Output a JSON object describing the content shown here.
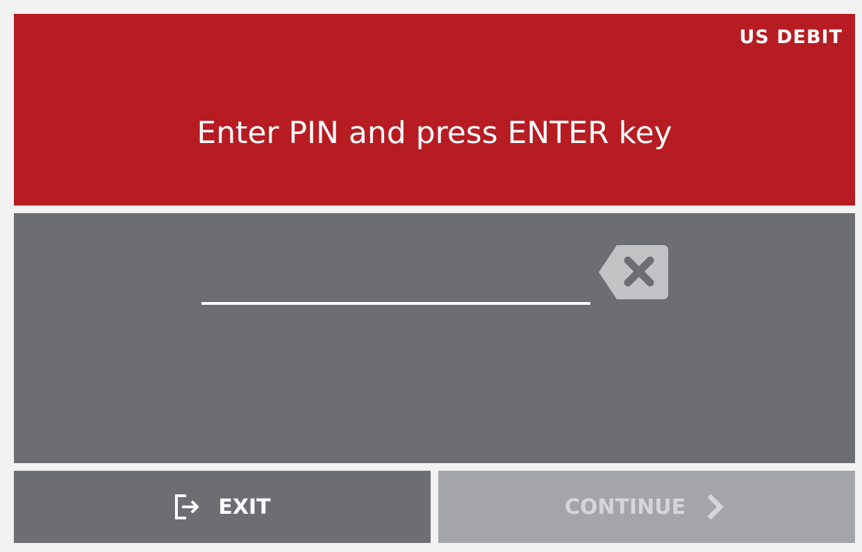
{
  "header": {
    "card_type": "US DEBIT",
    "prompt": "Enter PIN and press ENTER key",
    "background_color": "#b71c22"
  },
  "pin_entry": {
    "value": "",
    "clear_icon": "backspace-clear-icon",
    "panel_color": "#6d6e72"
  },
  "footer": {
    "exit_label": "EXIT",
    "exit_icon": "exit-arrow-icon",
    "continue_label": "CONTINUE",
    "continue_icon": "chevron-right-icon",
    "continue_disabled": true
  }
}
